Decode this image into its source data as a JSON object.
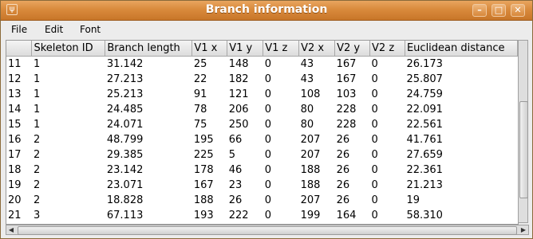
{
  "window": {
    "title": "Branch information",
    "app_icon_glyph": "ψ",
    "controls": {
      "minimize_glyph": "–",
      "maximize_glyph": "□",
      "close_glyph": "✕"
    }
  },
  "menu": [
    "File",
    "Edit",
    "Font"
  ],
  "table": {
    "columns": [
      "",
      "Skeleton ID",
      "Branch length",
      "V1 x",
      "V1 y",
      "V1 z",
      "V2 x",
      "V2 y",
      "V2 z",
      "Euclidean distance"
    ],
    "rows": [
      [
        "11",
        "1",
        "31.142",
        "25",
        "148",
        "0",
        "43",
        "167",
        "0",
        "26.173"
      ],
      [
        "12",
        "1",
        "27.213",
        "22",
        "182",
        "0",
        "43",
        "167",
        "0",
        "25.807"
      ],
      [
        "13",
        "1",
        "25.213",
        "91",
        "121",
        "0",
        "108",
        "103",
        "0",
        "24.759"
      ],
      [
        "14",
        "1",
        "24.485",
        "78",
        "206",
        "0",
        "80",
        "228",
        "0",
        "22.091"
      ],
      [
        "15",
        "1",
        "24.071",
        "75",
        "250",
        "0",
        "80",
        "228",
        "0",
        "22.561"
      ],
      [
        "16",
        "2",
        "48.799",
        "195",
        "66",
        "0",
        "207",
        "26",
        "0",
        "41.761"
      ],
      [
        "17",
        "2",
        "29.385",
        "225",
        "5",
        "0",
        "207",
        "26",
        "0",
        "27.659"
      ],
      [
        "18",
        "2",
        "23.142",
        "178",
        "46",
        "0",
        "188",
        "26",
        "0",
        "22.361"
      ],
      [
        "19",
        "2",
        "23.071",
        "167",
        "23",
        "0",
        "188",
        "26",
        "0",
        "21.213"
      ],
      [
        "20",
        "2",
        "18.828",
        "188",
        "26",
        "0",
        "207",
        "26",
        "0",
        "19"
      ],
      [
        "21",
        "3",
        "67.113",
        "193",
        "222",
        "0",
        "199",
        "164",
        "0",
        "58.310"
      ]
    ]
  },
  "scrollbars": {
    "vertical_position_pct": 42,
    "horizontal_position_pct": 0
  }
}
